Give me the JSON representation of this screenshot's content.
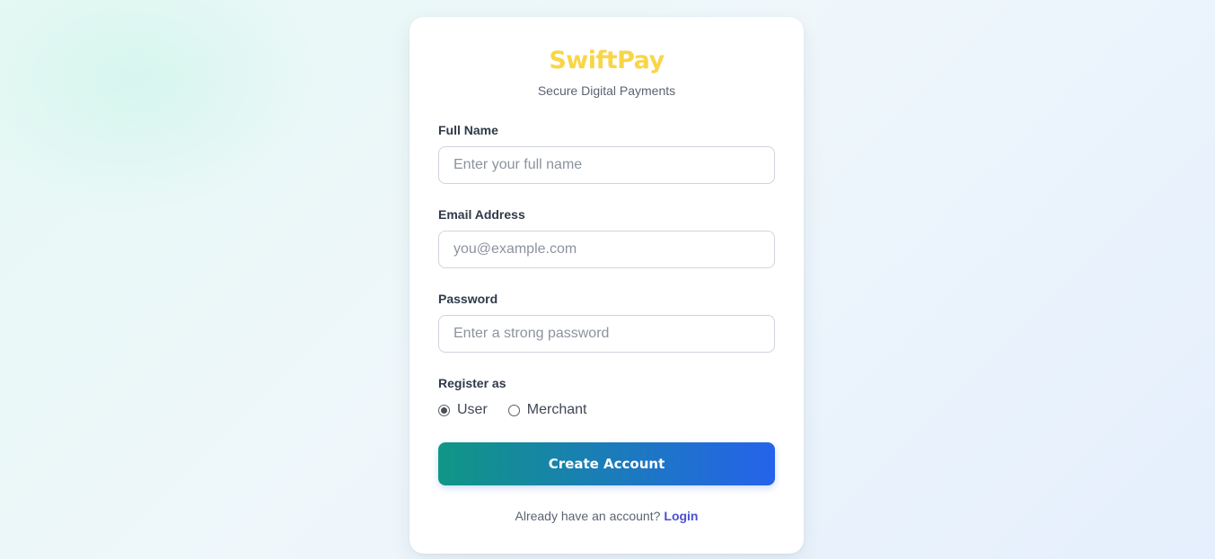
{
  "brand": {
    "name": "SwiftPay",
    "tagline": "Secure Digital Payments",
    "color": "#f8d648"
  },
  "form": {
    "full_name": {
      "label": "Full Name",
      "placeholder": "Enter your full name",
      "value": ""
    },
    "email": {
      "label": "Email Address",
      "placeholder": "you@example.com",
      "value": ""
    },
    "password": {
      "label": "Password",
      "placeholder": "Enter a strong password",
      "value": ""
    },
    "register_as": {
      "label": "Register as",
      "options": [
        {
          "label": "User",
          "selected": true
        },
        {
          "label": "Merchant",
          "selected": false
        }
      ]
    },
    "submit_label": "Create Account",
    "submit_gradient": [
      "#109685",
      "#2563eb"
    ]
  },
  "footer": {
    "prompt": "Already have an account?",
    "link_label": "Login",
    "link_color": "#4a4fd6"
  }
}
